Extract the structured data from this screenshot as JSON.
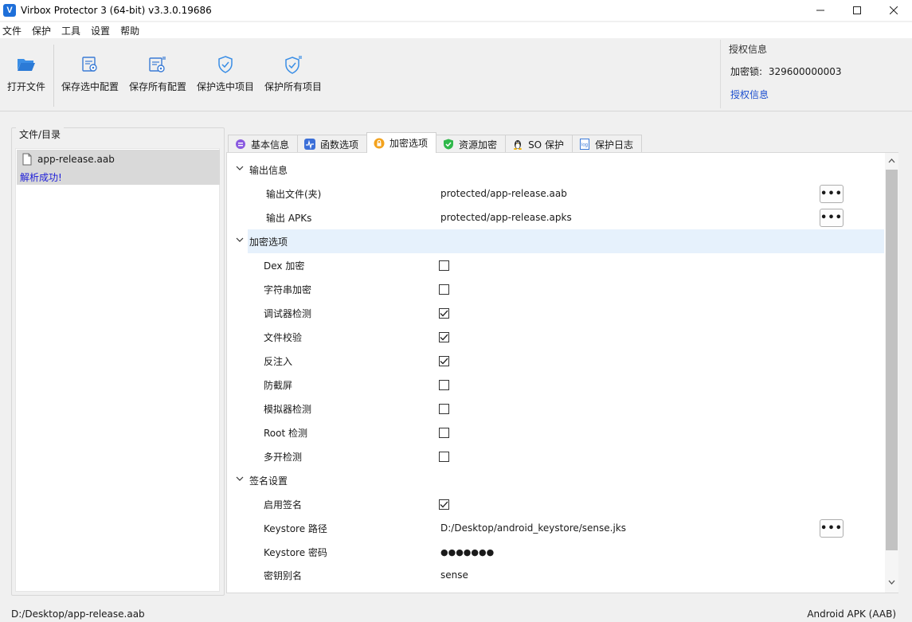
{
  "window": {
    "icon_letter": "V",
    "title": "Virbox Protector 3 (64-bit) v3.3.0.19686",
    "minimize": "—",
    "maximize": "☐",
    "close": "✕"
  },
  "menu": [
    "文件",
    "保护",
    "工具",
    "设置",
    "帮助"
  ],
  "toolbar": {
    "open_file": "打开文件",
    "protect_selected_config": "保存选中配置",
    "protect_all_config": "保存所有配置",
    "protect_selected_project": "保护选中项目",
    "protect_all_projects": "保护所有项目"
  },
  "license": {
    "title": "授权信息",
    "key_label": "加密锁:",
    "key_value": "329600000003",
    "link": "授权信息"
  },
  "left_panel": {
    "title": "文件/目录",
    "file_name": "app-release.aab",
    "file_status": "解析成功!"
  },
  "tabs": [
    {
      "label": "基本信息",
      "icon": "chat-icon",
      "color": "#7a4fd6"
    },
    {
      "label": "函数选项",
      "icon": "wave-icon",
      "color": "#3b6fd8"
    },
    {
      "label": "加密选项",
      "icon": "lock-icon",
      "color": "#f0a020"
    },
    {
      "label": "资源加密",
      "icon": "shield-check-icon",
      "color": "#2fb84a"
    },
    {
      "label": "SO 保护",
      "icon": "linux-icon",
      "color": "#333333"
    },
    {
      "label": "保护日志",
      "icon": "log-icon",
      "color": "#3b7ad8"
    }
  ],
  "sections": {
    "output": {
      "title": "输出信息",
      "file_label": "输出文件(夹)",
      "file_value": "protected/app-release.aab",
      "apks_label": "输出 APKs",
      "apks_value": "protected/app-release.apks",
      "browse": "•••"
    },
    "encrypt": {
      "title": "加密选项",
      "options": [
        {
          "label": "Dex 加密",
          "checked": false
        },
        {
          "label": "字符串加密",
          "checked": false
        },
        {
          "label": "调试器检测",
          "checked": true
        },
        {
          "label": "文件校验",
          "checked": true
        },
        {
          "label": "反注入",
          "checked": true
        },
        {
          "label": "防截屏",
          "checked": false
        },
        {
          "label": "模拟器检测",
          "checked": false
        },
        {
          "label": "Root 检测",
          "checked": false
        },
        {
          "label": "多开检测",
          "checked": false
        }
      ]
    },
    "sign": {
      "title": "签名设置",
      "enable_label": "启用签名",
      "enable_checked": true,
      "keystore_path_label": "Keystore 路径",
      "keystore_path_value": "D:/Desktop/android_keystore/sense.jks",
      "keystore_pwd_label": "Keystore 密码",
      "keystore_pwd_value": "●●●●●●●",
      "alias_label": "密钥别名",
      "alias_value": "sense",
      "browse": "•••"
    }
  },
  "status": {
    "path": "D:/Desktop/app-release.aab",
    "type": "Android APK (AAB)"
  }
}
